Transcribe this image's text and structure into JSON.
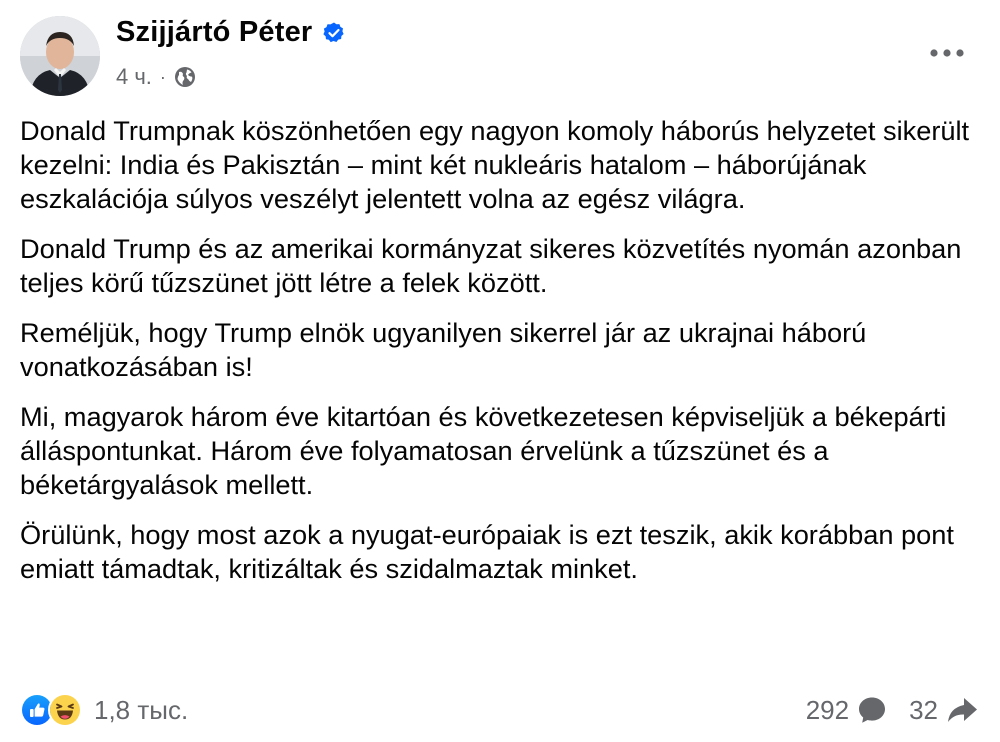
{
  "post": {
    "author": {
      "name": "Szijjártó Péter",
      "verified": true,
      "avatar_icon": "profile-photo"
    },
    "meta": {
      "time": "4 ч.",
      "separator": "·",
      "audience_icon": "globe-icon"
    },
    "more_icon": "more-horizontal-icon",
    "paragraphs": [
      "Donald Trumpnak köszönhetően egy nagyon komoly háborús helyzetet sikerült kezelni: India és Pakisztán – mint két nukleáris hatalom – háborújának eszkalációja súlyos veszélyt jelentett volna az egész világra.",
      "Donald Trump és az amerikai kormányzat sikeres közvetítés nyomán azonban teljes körű tűzszünet jött létre a felek között.",
      "Reméljük, hogy Trump elnök ugyanilyen sikerrel jár az ukrajnai háború vonatkozásában is!",
      "Mi, magyarok három éve kitartóan és következetesen képviseljük a békepárti álláspontunkat. Három éve folyamatosan érvelünk a tűzszünet és a béketárgyalások mellett.",
      "Örülünk, hogy most azok a nyugat-európaiak is ezt teszik, akik korábban pont emiatt támadtak, kritizáltak és szidalmaztak minket."
    ],
    "footer": {
      "reactions": {
        "icons": [
          "like-icon",
          "haha-icon"
        ],
        "count": "1,8 тыс."
      },
      "comments": {
        "count": "292",
        "icon": "comment-icon"
      },
      "shares": {
        "count": "32",
        "icon": "share-icon"
      }
    },
    "colors": {
      "text": "#050505",
      "secondary": "#65676b",
      "verified_blue": "#0866ff",
      "like_blue": "#1877f2",
      "haha_yellow": "#fcd34d"
    }
  }
}
